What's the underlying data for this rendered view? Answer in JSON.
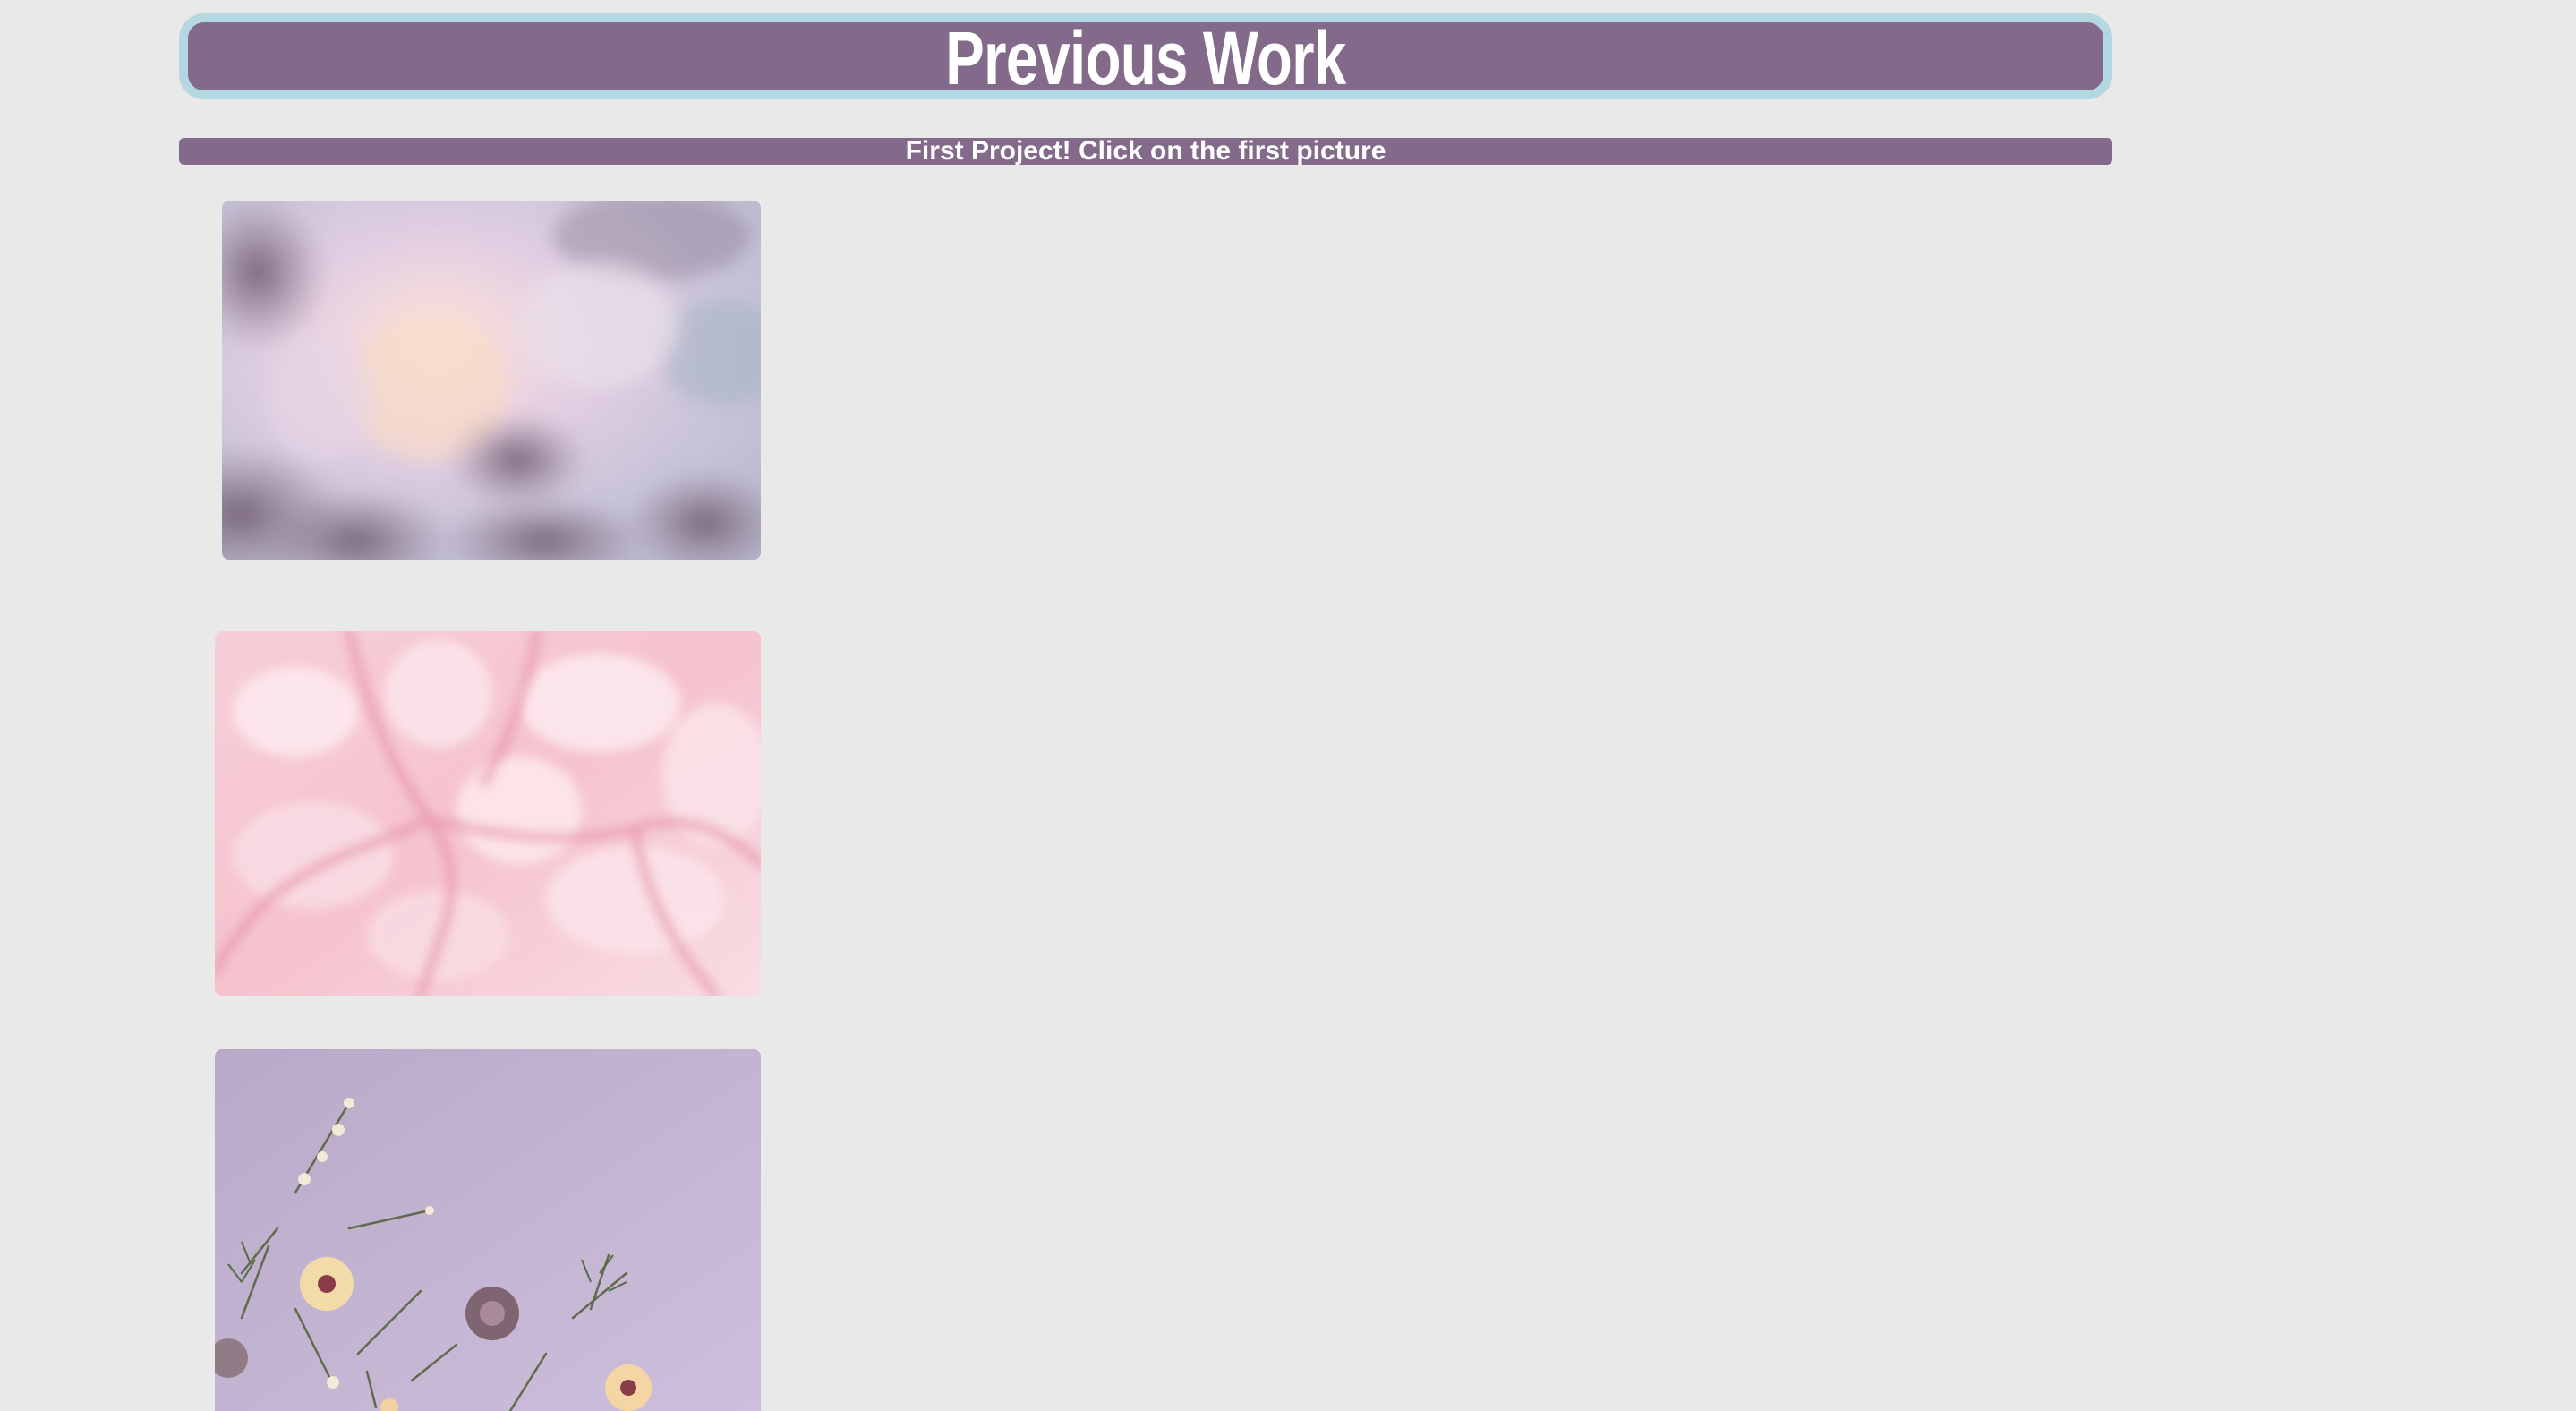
{
  "header": {
    "title": "Previous Work"
  },
  "subheader": {
    "text": "First Project! Click on the first picture"
  },
  "gallery": {
    "images": [
      {
        "name": "pink-cloud-sky-image",
        "colors": [
          "#d9c6dc",
          "#f3d7dc",
          "#7a6678"
        ]
      },
      {
        "name": "pink-marble-fluid-art-image",
        "colors": [
          "#f6c4cf",
          "#fbe6ea",
          "#e08fa4"
        ]
      },
      {
        "name": "dried-flowers-on-lilac-image",
        "colors": [
          "#c5b3d4",
          "#f3e3c0",
          "#6d7a58"
        ]
      }
    ]
  },
  "colors": {
    "background": "#e9e9e9",
    "bar": "#836a8a",
    "title_border": "#b4d8e1",
    "text": "#ffffff"
  }
}
